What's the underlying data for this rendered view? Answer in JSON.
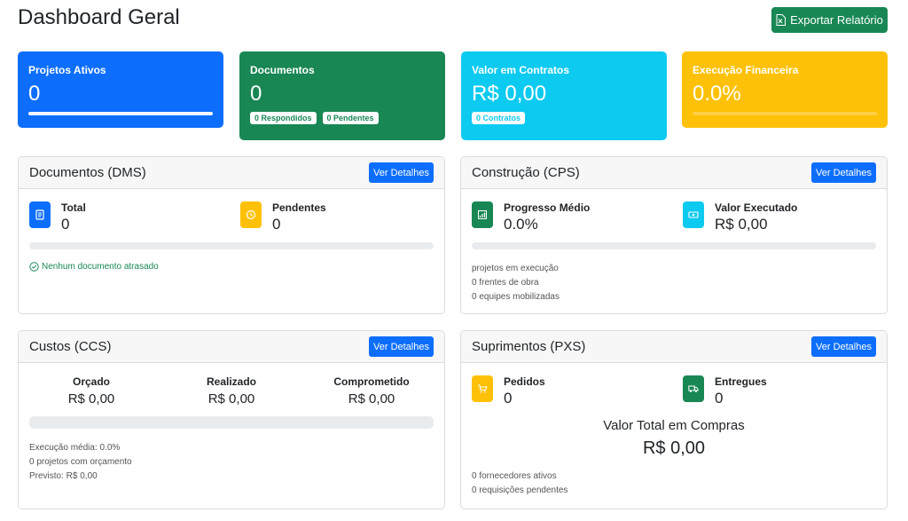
{
  "header": {
    "title": "Dashboard Geral",
    "export_label": "Exportar Relatório"
  },
  "colors": {
    "primary": "#0d6efd",
    "success": "#198754",
    "info": "#0dcaf0",
    "warning": "#ffc107"
  },
  "stats": {
    "projetos": {
      "label": "Projetos Ativos",
      "value": "0"
    },
    "documentos": {
      "label": "Documentos",
      "value": "0",
      "badges": [
        "0 Respondidos",
        "0 Pendentes"
      ]
    },
    "contratos": {
      "label": "Valor em Contratos",
      "value": "R$ 0,00",
      "badge": "0 Contratos"
    },
    "financeira": {
      "label": "Execução Financeira",
      "value": "0.0%",
      "progress": 0
    }
  },
  "dms": {
    "title": "Documentos (DMS)",
    "button": "Ver Detalhes",
    "total_label": "Total",
    "total_value": "0",
    "pend_label": "Pendentes",
    "pend_value": "0",
    "progress": 0,
    "status": "Nenhum documento atrasado"
  },
  "cps": {
    "title": "Construção (CPS)",
    "button": "Ver Detalhes",
    "prog_label": "Progresso Médio",
    "prog_value": "0.0%",
    "exec_label": "Valor Executado",
    "exec_value": "R$ 0,00",
    "progress": 0,
    "lines": [
      "projetos em execução",
      "0 frentes de obra",
      "0 equipes mobilizadas"
    ]
  },
  "ccs": {
    "title": "Custos (CCS)",
    "button": "Ver Detalhes",
    "cols": [
      {
        "label": "Orçado",
        "value": "R$ 0,00"
      },
      {
        "label": "Realizado",
        "value": "R$ 0,00"
      },
      {
        "label": "Comprometido",
        "value": "R$ 0,00"
      }
    ],
    "progress": 0,
    "lines": [
      "Execução média: 0.0%",
      "0 projetos com orçamento",
      "Previsto: R$ 0,00"
    ]
  },
  "pxs": {
    "title": "Suprimentos (PXS)",
    "button": "Ver Detalhes",
    "ped_label": "Pedidos",
    "ped_value": "0",
    "ent_label": "Entregues",
    "ent_value": "0",
    "total_label": "Valor Total em Compras",
    "total_value": "R$ 0,00",
    "lines": [
      "0 fornecedores ativos",
      "0 requisições pendentes"
    ]
  }
}
